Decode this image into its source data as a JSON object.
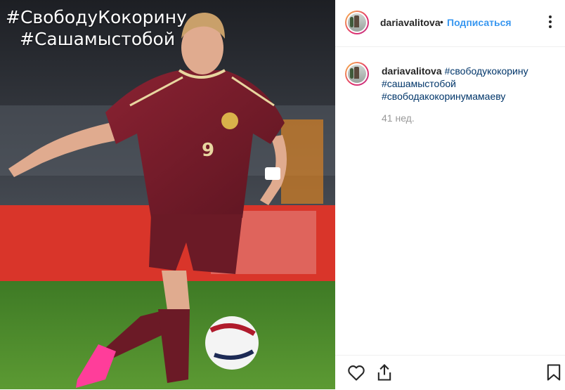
{
  "photo": {
    "overlay_line1": "#СвободуКокорину",
    "overlay_line2": "#Сашамыстобой",
    "jersey_number": "9"
  },
  "header": {
    "username": "dariavalitova",
    "separator": "•",
    "follow_label": "Подписаться",
    "more_icon": "more-dots-icon"
  },
  "caption": {
    "username": "dariavalitova",
    "tags": [
      "#свободукокорину",
      "#сашамыстобой",
      "#свободакокоринумамаеву"
    ],
    "time": "41 нед."
  },
  "actions": {
    "like_icon": "heart-icon",
    "share_icon": "share-icon",
    "save_icon": "bookmark-icon"
  },
  "colors": {
    "link": "#3897f0",
    "hashtag": "#003569",
    "jersey": "#7a1f2b",
    "pitch": "#4f8a2c"
  }
}
